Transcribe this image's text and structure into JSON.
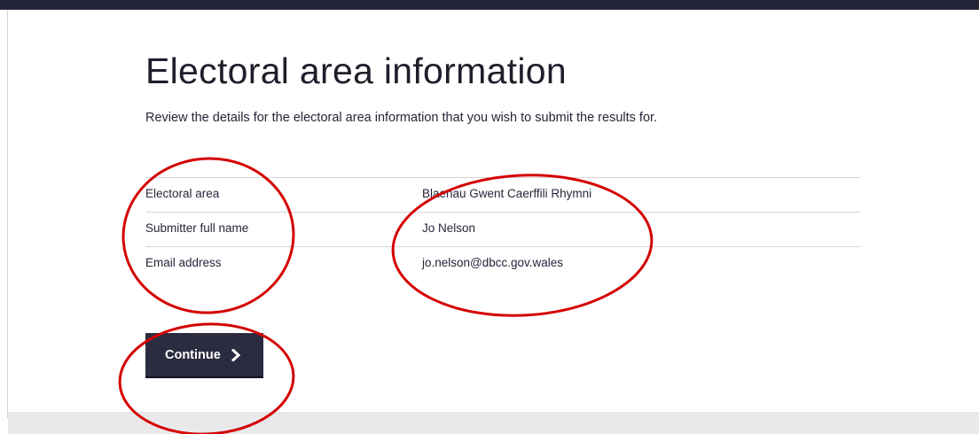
{
  "page": {
    "title": "Electoral area information",
    "intro": "Review the details for the electoral area information that you wish to submit the results for."
  },
  "summary": {
    "rows": [
      {
        "key": "Electoral area",
        "value": "Blaenau Gwent Caerffili Rhymni"
      },
      {
        "key": "Submitter full name",
        "value": "Jo Nelson"
      },
      {
        "key": "Email address",
        "value": "jo.nelson@dbcc.gov.wales"
      }
    ]
  },
  "actions": {
    "continue_label": "Continue",
    "continue_icon": "chevron-right-icon"
  },
  "colors": {
    "header_bar": "#25253a",
    "button": "#2c2c40",
    "annotation": "#d40000",
    "divider": "#d6d6da"
  },
  "annotations": [
    {
      "name": "annotation-circle-keys",
      "shape": "ellipse"
    },
    {
      "name": "annotation-circle-values",
      "shape": "ellipse"
    },
    {
      "name": "annotation-circle-continue",
      "shape": "ellipse"
    }
  ]
}
